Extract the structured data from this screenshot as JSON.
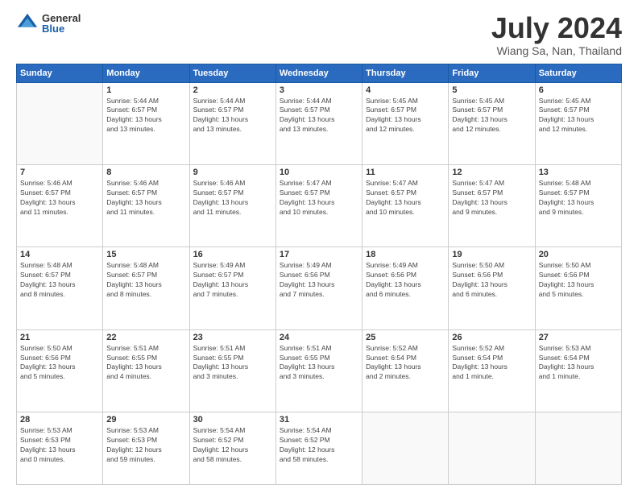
{
  "logo": {
    "general": "General",
    "blue": "Blue"
  },
  "header": {
    "month": "July 2024",
    "location": "Wiang Sa, Nan, Thailand"
  },
  "days_of_week": [
    "Sunday",
    "Monday",
    "Tuesday",
    "Wednesday",
    "Thursday",
    "Friday",
    "Saturday"
  ],
  "weeks": [
    [
      {
        "day": "",
        "info": ""
      },
      {
        "day": "1",
        "info": "Sunrise: 5:44 AM\nSunset: 6:57 PM\nDaylight: 13 hours\nand 13 minutes."
      },
      {
        "day": "2",
        "info": "Sunrise: 5:44 AM\nSunset: 6:57 PM\nDaylight: 13 hours\nand 13 minutes."
      },
      {
        "day": "3",
        "info": "Sunrise: 5:44 AM\nSunset: 6:57 PM\nDaylight: 13 hours\nand 13 minutes."
      },
      {
        "day": "4",
        "info": "Sunrise: 5:45 AM\nSunset: 6:57 PM\nDaylight: 13 hours\nand 12 minutes."
      },
      {
        "day": "5",
        "info": "Sunrise: 5:45 AM\nSunset: 6:57 PM\nDaylight: 13 hours\nand 12 minutes."
      },
      {
        "day": "6",
        "info": "Sunrise: 5:45 AM\nSunset: 6:57 PM\nDaylight: 13 hours\nand 12 minutes."
      }
    ],
    [
      {
        "day": "7",
        "info": "Sunrise: 5:46 AM\nSunset: 6:57 PM\nDaylight: 13 hours\nand 11 minutes."
      },
      {
        "day": "8",
        "info": "Sunrise: 5:46 AM\nSunset: 6:57 PM\nDaylight: 13 hours\nand 11 minutes."
      },
      {
        "day": "9",
        "info": "Sunrise: 5:46 AM\nSunset: 6:57 PM\nDaylight: 13 hours\nand 11 minutes."
      },
      {
        "day": "10",
        "info": "Sunrise: 5:47 AM\nSunset: 6:57 PM\nDaylight: 13 hours\nand 10 minutes."
      },
      {
        "day": "11",
        "info": "Sunrise: 5:47 AM\nSunset: 6:57 PM\nDaylight: 13 hours\nand 10 minutes."
      },
      {
        "day": "12",
        "info": "Sunrise: 5:47 AM\nSunset: 6:57 PM\nDaylight: 13 hours\nand 9 minutes."
      },
      {
        "day": "13",
        "info": "Sunrise: 5:48 AM\nSunset: 6:57 PM\nDaylight: 13 hours\nand 9 minutes."
      }
    ],
    [
      {
        "day": "14",
        "info": "Sunrise: 5:48 AM\nSunset: 6:57 PM\nDaylight: 13 hours\nand 8 minutes."
      },
      {
        "day": "15",
        "info": "Sunrise: 5:48 AM\nSunset: 6:57 PM\nDaylight: 13 hours\nand 8 minutes."
      },
      {
        "day": "16",
        "info": "Sunrise: 5:49 AM\nSunset: 6:57 PM\nDaylight: 13 hours\nand 7 minutes."
      },
      {
        "day": "17",
        "info": "Sunrise: 5:49 AM\nSunset: 6:56 PM\nDaylight: 13 hours\nand 7 minutes."
      },
      {
        "day": "18",
        "info": "Sunrise: 5:49 AM\nSunset: 6:56 PM\nDaylight: 13 hours\nand 6 minutes."
      },
      {
        "day": "19",
        "info": "Sunrise: 5:50 AM\nSunset: 6:56 PM\nDaylight: 13 hours\nand 6 minutes."
      },
      {
        "day": "20",
        "info": "Sunrise: 5:50 AM\nSunset: 6:56 PM\nDaylight: 13 hours\nand 5 minutes."
      }
    ],
    [
      {
        "day": "21",
        "info": "Sunrise: 5:50 AM\nSunset: 6:56 PM\nDaylight: 13 hours\nand 5 minutes."
      },
      {
        "day": "22",
        "info": "Sunrise: 5:51 AM\nSunset: 6:55 PM\nDaylight: 13 hours\nand 4 minutes."
      },
      {
        "day": "23",
        "info": "Sunrise: 5:51 AM\nSunset: 6:55 PM\nDaylight: 13 hours\nand 3 minutes."
      },
      {
        "day": "24",
        "info": "Sunrise: 5:51 AM\nSunset: 6:55 PM\nDaylight: 13 hours\nand 3 minutes."
      },
      {
        "day": "25",
        "info": "Sunrise: 5:52 AM\nSunset: 6:54 PM\nDaylight: 13 hours\nand 2 minutes."
      },
      {
        "day": "26",
        "info": "Sunrise: 5:52 AM\nSunset: 6:54 PM\nDaylight: 13 hours\nand 1 minute."
      },
      {
        "day": "27",
        "info": "Sunrise: 5:53 AM\nSunset: 6:54 PM\nDaylight: 13 hours\nand 1 minute."
      }
    ],
    [
      {
        "day": "28",
        "info": "Sunrise: 5:53 AM\nSunset: 6:53 PM\nDaylight: 13 hours\nand 0 minutes."
      },
      {
        "day": "29",
        "info": "Sunrise: 5:53 AM\nSunset: 6:53 PM\nDaylight: 12 hours\nand 59 minutes."
      },
      {
        "day": "30",
        "info": "Sunrise: 5:54 AM\nSunset: 6:52 PM\nDaylight: 12 hours\nand 58 minutes."
      },
      {
        "day": "31",
        "info": "Sunrise: 5:54 AM\nSunset: 6:52 PM\nDaylight: 12 hours\nand 58 minutes."
      },
      {
        "day": "",
        "info": ""
      },
      {
        "day": "",
        "info": ""
      },
      {
        "day": "",
        "info": ""
      }
    ]
  ]
}
